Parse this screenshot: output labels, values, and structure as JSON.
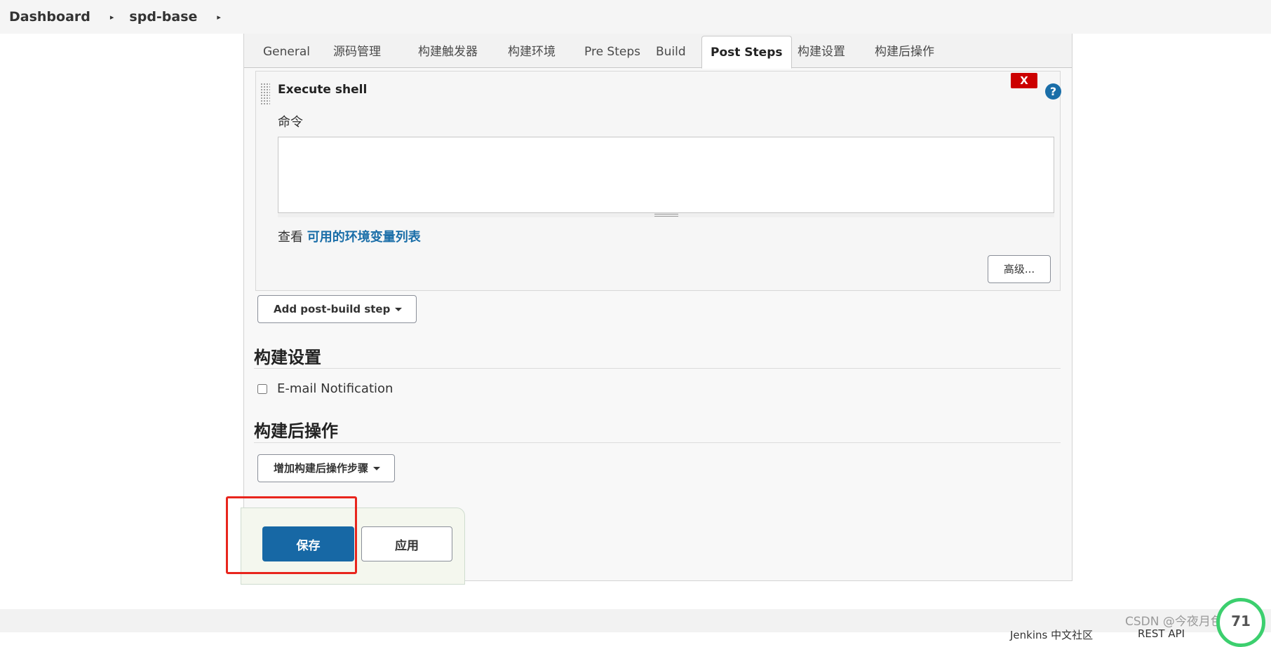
{
  "breadcrumb": {
    "items": [
      "Dashboard",
      "spd-base"
    ],
    "separator": "▸"
  },
  "tabs": [
    {
      "label": "General",
      "active": false
    },
    {
      "label": "源码管理",
      "active": false
    },
    {
      "label": "构建触发器",
      "active": false
    },
    {
      "label": "构建环境",
      "active": false
    },
    {
      "label": "Pre Steps",
      "active": false
    },
    {
      "label": "Build",
      "active": false
    },
    {
      "label": "Post Steps",
      "active": true
    },
    {
      "label": "构建设置",
      "active": false
    },
    {
      "label": "构建后操作",
      "active": false
    }
  ],
  "execute_shell": {
    "title": "Execute shell",
    "close_label": "X",
    "help_label": "?",
    "command_label": "命令",
    "command_value": "",
    "env_prefix": "查看 ",
    "env_link": "可用的环境变量列表",
    "advanced_label": "高级..."
  },
  "add_post_build_step": "Add post-build step",
  "build_settings": {
    "title": "构建设置",
    "email_label": "E-mail Notification",
    "email_checked": false
  },
  "post_build_actions": {
    "title": "构建后操作",
    "add_label": "增加构建后操作步骤"
  },
  "actions": {
    "save_label": "保存",
    "apply_label": "应用"
  },
  "footer": {
    "left_text": "Jenkins 中文社区",
    "right_text": "REST API"
  },
  "watermark": "CSDN @今夜月色很美",
  "gauge_label": "71",
  "colors": {
    "primary": "#1768a5",
    "close_red": "#cc0000",
    "highlight_red": "#e8251d",
    "link": "#1a6ea8"
  }
}
